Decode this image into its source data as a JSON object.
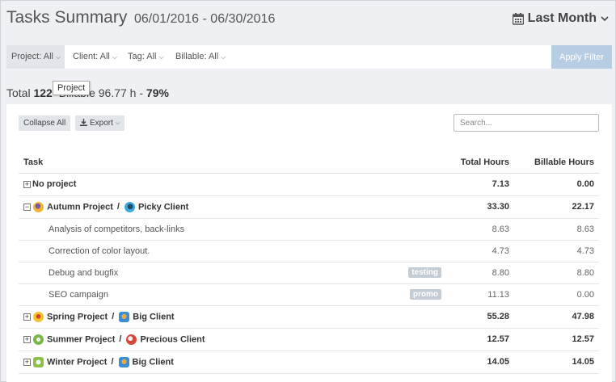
{
  "header": {
    "title": "Tasks Summary",
    "date_range": "06/01/2016 - 06/30/2016",
    "period_label": "Last Month"
  },
  "filters": {
    "project": "Project: All",
    "client": "Client: All",
    "tag": "Tag: All",
    "billable": "Billable: All",
    "apply_label": "Apply Filter"
  },
  "tooltip": "Project",
  "summary": {
    "total_label": "Total",
    "total_value": "122",
    "billable_label": "Billable 96.77 h -",
    "billable_percent": "79%"
  },
  "toolbar": {
    "collapse_label": "Collapse All",
    "export_label": "Export",
    "search_placeholder": "Search..."
  },
  "table": {
    "col_task": "Task",
    "col_total": "Total Hours",
    "col_billable": "Billable Hours",
    "rows": [
      {
        "project": "No project",
        "total": "7.13",
        "billable": "0.00"
      },
      {
        "project": "Autumn Project",
        "client": "Picky Client",
        "total": "33.30",
        "billable": "22.17"
      },
      {
        "task": "Analysis of competitors, back-links",
        "total": "8.63",
        "billable": "8.63"
      },
      {
        "task": "Correction of color layout.",
        "total": "4.73",
        "billable": "4.73"
      },
      {
        "task": "Debug and bugfix",
        "tag": "testing",
        "total": "8.80",
        "billable": "8.80"
      },
      {
        "task": "SEO campaign",
        "tag": "promo",
        "total": "11.13",
        "billable": "0.00"
      },
      {
        "project": "Spring Project",
        "client": "Big Client",
        "total": "55.28",
        "billable": "47.98"
      },
      {
        "project": "Summer Project",
        "client": "Precious Client",
        "total": "12.57",
        "billable": "12.57"
      },
      {
        "project": "Winter Project",
        "client": "Big Client",
        "total": "14.05",
        "billable": "14.05"
      }
    ]
  },
  "colors": {
    "apply_button": "#b7cde4",
    "tag_bg": "#c4ccd5",
    "background": "#eef0f3"
  }
}
